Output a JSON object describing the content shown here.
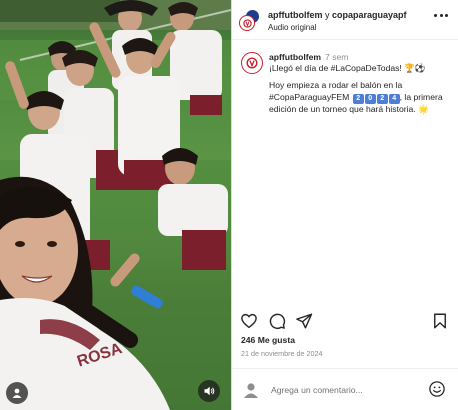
{
  "post": {
    "header": {
      "author": "apffutbolfem",
      "connector": "y",
      "collaborator": "copaparaguayapf",
      "audio": "Audio original"
    },
    "caption": {
      "username": "apffutbolfem",
      "time": "7 sem",
      "line1": "¡Llegó el día de #LaCopaDeTodas! 🏆⚽",
      "para_pre": "Hoy empieza a rodar el balón en la #CopaParaguayFEM",
      "year_digits": [
        "2",
        "0",
        "2",
        "4"
      ],
      "para_post": ", la primera edición de un torneo que hará historia. 🌟"
    },
    "likes": "246 Me gusta",
    "date": "21 de noviembre de 2024",
    "comment_placeholder": "Agrega un comentario..."
  },
  "icons": {
    "like": "heart-icon",
    "comment": "comment-icon",
    "share": "send-icon",
    "save": "bookmark-icon",
    "more": "more-icon",
    "emoji": "emoji-icon",
    "audio": "speaker-icon",
    "tagged_user": "user-icon"
  },
  "colors": {
    "brand_red": "#c8202f",
    "jersey_maroon": "#7a1f2b",
    "link": "#00376b",
    "muted": "#8e8e8e"
  }
}
